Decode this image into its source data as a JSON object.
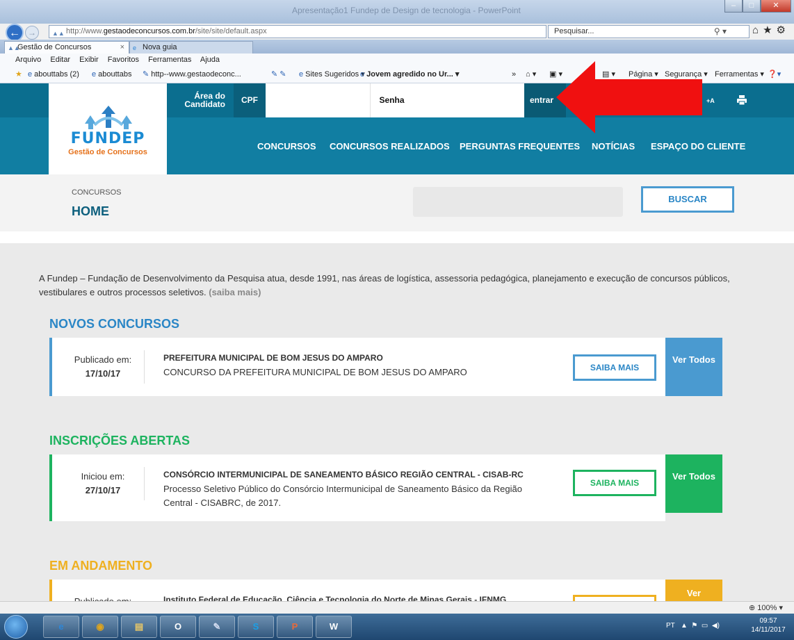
{
  "browser": {
    "window_title": "Apresentação1 Fundep de Design de tecnologia - PowerPoint",
    "address_prefix": "http://www.",
    "address_domain": "gestaodeconcursos.com.br",
    "address_path": "/site/site/default.aspx",
    "search_placeholder": "Pesquisar...",
    "tabs": [
      {
        "label": "Gestão de Concursos"
      },
      {
        "label": "Nova guia"
      }
    ],
    "menu": [
      "Arquivo",
      "Editar",
      "Exibir",
      "Favoritos",
      "Ferramentas",
      "Ajuda"
    ],
    "favorites": [
      {
        "label": "abouttabs (2)"
      },
      {
        "label": "abouttabs"
      },
      {
        "label": "http--www.gestaodeconc..."
      },
      {
        "label": "Sites Sugeridos ▾"
      },
      {
        "label": "Jovem agredido no Ur... ▾"
      }
    ],
    "command_items": [
      "Página ▾",
      "Segurança ▾",
      "Ferramentas ▾"
    ],
    "zoom": "100%"
  },
  "site": {
    "logo_text": "FUNDEP",
    "logo_sub": "Gestão de Concursos",
    "area_candidato": "Área do Candidato",
    "cpf_label": "CPF",
    "senha_label": "Senha",
    "entrar_label": "entrar",
    "font_increase": "+A",
    "nav": [
      "CONCURSOS",
      "CONCURSOS REALIZADOS",
      "PERGUNTAS FREQUENTES",
      "NOTÍCIAS",
      "ESPAÇO DO CLIENTE"
    ]
  },
  "breadcrumb": {
    "section": "CONCURSOS",
    "title": "HOME",
    "search_button": "BUSCAR"
  },
  "intro": {
    "text": "A Fundep – Fundação de Desenvolvimento da Pesquisa atua, desde 1991, nas áreas de logística, assessoria pedagógica, planejamento e execução de concursos públicos, vestibulares e outros processos seletivos.",
    "more": "(saiba mais)"
  },
  "sections": [
    {
      "title": "NOVOS CONCURSOS",
      "color": "#4a9ad0",
      "label": "Publicado em:",
      "date": "17/10/17",
      "card_title": "PREFEITURA MUNICIPAL DE BOM JESUS DO AMPARO",
      "card_desc": "CONCURSO DA PREFEITURA MUNICIPAL DE BOM JESUS DO AMPARO",
      "saiba": "SAIBA MAIS",
      "ver_todos": "Ver Todos"
    },
    {
      "title": "INSCRIÇÕES ABERTAS",
      "color": "#1db35f",
      "label": "Iniciou em:",
      "date": "27/10/17",
      "card_title": "CONSÓRCIO INTERMUNICIPAL DE SANEAMENTO BÁSICO REGIÃO CENTRAL - CISAB-RC",
      "card_desc": "Processo Seletivo Público do Consórcio Intermunicipal de Saneamento Básico da Região Central - CISABRC, de 2017.",
      "saiba": "SAIBA MAIS",
      "ver_todos": "Ver Todos"
    },
    {
      "title": "EM ANDAMENTO",
      "color": "#efb020",
      "label": "Publicado em:",
      "card_title": "Instituto Federal de Educação, Ciência e Tecnologia do Norte de Minas Gerais - IFNMG",
      "ver_todos": "Ver"
    }
  ],
  "taskbar": {
    "language": "PT",
    "time": "09:57",
    "date": "14/11/2017"
  }
}
